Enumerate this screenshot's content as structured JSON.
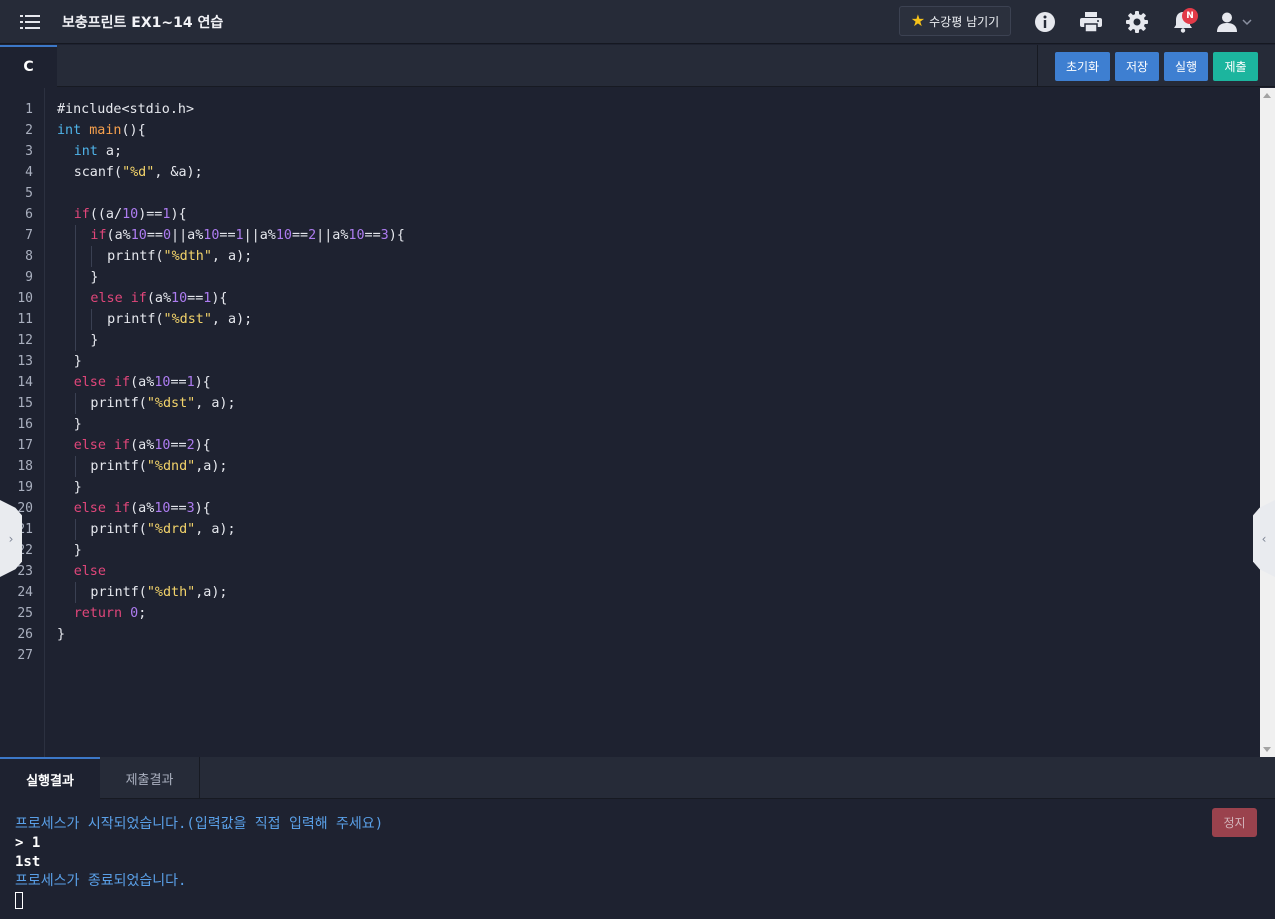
{
  "header": {
    "title": "보충프린트 EX1~14 연습",
    "review_button": "수강평 남기기",
    "notification_badge": "N",
    "icons": [
      "menu-icon",
      "info-icon",
      "print-icon",
      "gear-icon",
      "bell-icon",
      "user-icon",
      "chevron-down-icon"
    ]
  },
  "editor": {
    "language_tab": "C",
    "actions": {
      "reset": "초기화",
      "save": "저장",
      "run": "실행",
      "submit": "제출"
    },
    "lines": [
      {
        "n": "1",
        "indent": 0,
        "tokens": [
          [
            "",
            "#include<stdio.h>"
          ]
        ]
      },
      {
        "n": "2",
        "indent": 0,
        "tokens": [
          [
            "ty",
            "int"
          ],
          [
            "",
            " "
          ],
          [
            "fn",
            "main"
          ],
          [
            "",
            "(){"
          ]
        ]
      },
      {
        "n": "3",
        "indent": 1,
        "tokens": [
          [
            "ty",
            "int"
          ],
          [
            "",
            " a;"
          ]
        ]
      },
      {
        "n": "4",
        "indent": 1,
        "tokens": [
          [
            "",
            "scanf("
          ],
          [
            "str",
            "\"%d\""
          ],
          [
            "",
            ", &a);"
          ]
        ]
      },
      {
        "n": "5",
        "indent": 0,
        "tokens": []
      },
      {
        "n": "6",
        "indent": 1,
        "tokens": [
          [
            "kw",
            "if"
          ],
          [
            "",
            "((a/"
          ],
          [
            "num",
            "10"
          ],
          [
            "",
            ")=="
          ],
          [
            "num",
            "1"
          ],
          [
            "",
            "){"
          ]
        ]
      },
      {
        "n": "7",
        "indent": 2,
        "tokens": [
          [
            "kw",
            "if"
          ],
          [
            "",
            "(a%"
          ],
          [
            "num",
            "10"
          ],
          [
            "",
            "=="
          ],
          [
            "num",
            "0"
          ],
          [
            "",
            "||a%"
          ],
          [
            "num",
            "10"
          ],
          [
            "",
            "=="
          ],
          [
            "num",
            "1"
          ],
          [
            "",
            "||a%"
          ],
          [
            "num",
            "10"
          ],
          [
            "",
            "=="
          ],
          [
            "num",
            "2"
          ],
          [
            "",
            "||a%"
          ],
          [
            "num",
            "10"
          ],
          [
            "",
            "=="
          ],
          [
            "num",
            "3"
          ],
          [
            "",
            "){"
          ]
        ]
      },
      {
        "n": "8",
        "indent": 3,
        "tokens": [
          [
            "",
            "printf("
          ],
          [
            "str",
            "\"%dth\""
          ],
          [
            "",
            ", a);"
          ]
        ]
      },
      {
        "n": "9",
        "indent": 2,
        "tokens": [
          [
            "",
            "}"
          ]
        ]
      },
      {
        "n": "10",
        "indent": 2,
        "tokens": [
          [
            "kw",
            "else"
          ],
          [
            "",
            " "
          ],
          [
            "kw",
            "if"
          ],
          [
            "",
            "(a%"
          ],
          [
            "num",
            "10"
          ],
          [
            "",
            "=="
          ],
          [
            "num",
            "1"
          ],
          [
            "",
            "){"
          ]
        ]
      },
      {
        "n": "11",
        "indent": 3,
        "tokens": [
          [
            "",
            "printf("
          ],
          [
            "str",
            "\"%dst\""
          ],
          [
            "",
            ", a);"
          ]
        ]
      },
      {
        "n": "12",
        "indent": 2,
        "tokens": [
          [
            "",
            "}"
          ]
        ]
      },
      {
        "n": "13",
        "indent": 1,
        "tokens": [
          [
            "",
            "}"
          ]
        ]
      },
      {
        "n": "14",
        "indent": 1,
        "tokens": [
          [
            "kw",
            "else"
          ],
          [
            "",
            " "
          ],
          [
            "kw",
            "if"
          ],
          [
            "",
            "(a%"
          ],
          [
            "num",
            "10"
          ],
          [
            "",
            "=="
          ],
          [
            "num",
            "1"
          ],
          [
            "",
            "){"
          ]
        ]
      },
      {
        "n": "15",
        "indent": 2,
        "tokens": [
          [
            "",
            "printf("
          ],
          [
            "str",
            "\"%dst\""
          ],
          [
            "",
            ", a);"
          ]
        ]
      },
      {
        "n": "16",
        "indent": 1,
        "tokens": [
          [
            "",
            "}"
          ]
        ]
      },
      {
        "n": "17",
        "indent": 1,
        "tokens": [
          [
            "kw",
            "else"
          ],
          [
            "",
            " "
          ],
          [
            "kw",
            "if"
          ],
          [
            "",
            "(a%"
          ],
          [
            "num",
            "10"
          ],
          [
            "",
            "=="
          ],
          [
            "num",
            "2"
          ],
          [
            "",
            "){"
          ]
        ]
      },
      {
        "n": "18",
        "indent": 2,
        "tokens": [
          [
            "",
            "printf("
          ],
          [
            "str",
            "\"%dnd\""
          ],
          [
            "",
            ",a);"
          ]
        ]
      },
      {
        "n": "19",
        "indent": 1,
        "tokens": [
          [
            "",
            "}"
          ]
        ]
      },
      {
        "n": "20",
        "indent": 1,
        "tokens": [
          [
            "kw",
            "else"
          ],
          [
            "",
            " "
          ],
          [
            "kw",
            "if"
          ],
          [
            "",
            "(a%"
          ],
          [
            "num",
            "10"
          ],
          [
            "",
            "=="
          ],
          [
            "num",
            "3"
          ],
          [
            "",
            "){"
          ]
        ]
      },
      {
        "n": "21",
        "indent": 2,
        "tokens": [
          [
            "",
            "printf("
          ],
          [
            "str",
            "\"%drd\""
          ],
          [
            "",
            ", a);"
          ]
        ]
      },
      {
        "n": "22",
        "indent": 1,
        "tokens": [
          [
            "",
            "}"
          ]
        ]
      },
      {
        "n": "23",
        "indent": 1,
        "tokens": [
          [
            "kw",
            "else"
          ]
        ]
      },
      {
        "n": "24",
        "indent": 2,
        "tokens": [
          [
            "",
            "printf("
          ],
          [
            "str",
            "\"%dth\""
          ],
          [
            "",
            ",a);"
          ]
        ]
      },
      {
        "n": "25",
        "indent": 1,
        "tokens": [
          [
            "kw",
            "return"
          ],
          [
            "",
            " "
          ],
          [
            "num",
            "0"
          ],
          [
            "",
            ";"
          ]
        ]
      },
      {
        "n": "26",
        "indent": 0,
        "tokens": [
          [
            "",
            "}"
          ]
        ]
      },
      {
        "n": "27",
        "indent": 0,
        "tokens": []
      }
    ]
  },
  "result": {
    "tabs": {
      "run_result": "실행결과",
      "submit_result": "제출결과"
    },
    "stop_button": "정지",
    "console": [
      {
        "kind": "sys",
        "text": "프로세스가 시작되었습니다.(입력값을 직접 입력해 주세요)"
      },
      {
        "kind": "out",
        "text": "> 1"
      },
      {
        "kind": "out",
        "text": "1st"
      },
      {
        "kind": "sys",
        "text": "프로세스가 종료되었습니다."
      }
    ]
  },
  "colors": {
    "keyword": "#e0467a",
    "type": "#4fb3e8",
    "function": "#f6a04d",
    "number": "#ad7cf0",
    "string": "#f2d36a",
    "blue_button": "#3e7fd1",
    "teal_button": "#1cb59e",
    "stop_button": "#b94a55",
    "badge": "#e23a48"
  }
}
